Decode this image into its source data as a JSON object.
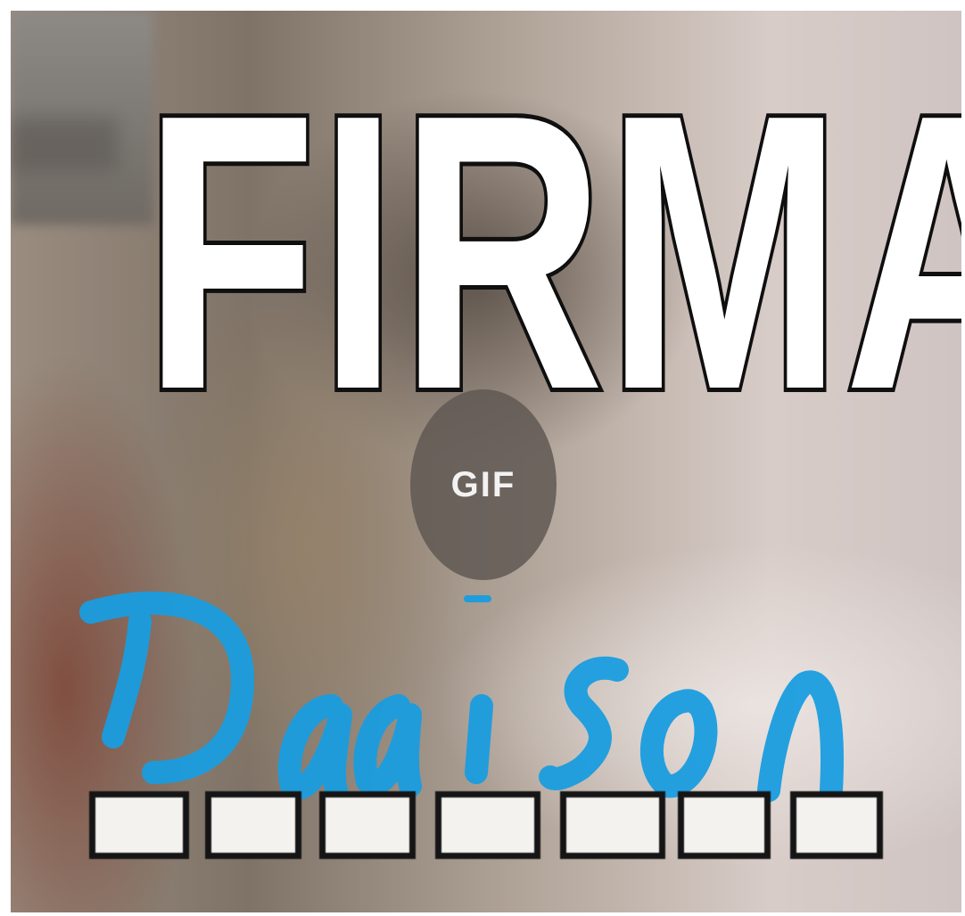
{
  "title": "FIRMA",
  "badge": {
    "label": "GIF"
  },
  "signature": {
    "text": "Daison",
    "color": "#1a9de0"
  },
  "colors": {
    "title_fill": "#ffffff",
    "title_outline": "#111111",
    "badge_bg": "#5f5852"
  }
}
